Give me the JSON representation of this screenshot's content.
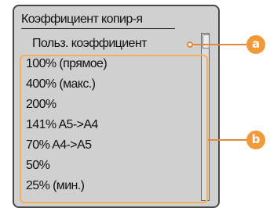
{
  "panel": {
    "title": "Коэффициент копир-я",
    "selected_item": "Польз. коэффициент",
    "items": [
      "100% (прямое)",
      "400% (макс.)",
      "200%",
      "141% A5->A4",
      "70% A4->A5",
      "50%",
      "25% (мин.)"
    ]
  },
  "callouts": {
    "a": "a",
    "b": "b"
  },
  "colors": {
    "panel_bg": "#d0d0d0",
    "callout_orange": "#f29a3a",
    "highlight_border": "#f5b05a"
  }
}
